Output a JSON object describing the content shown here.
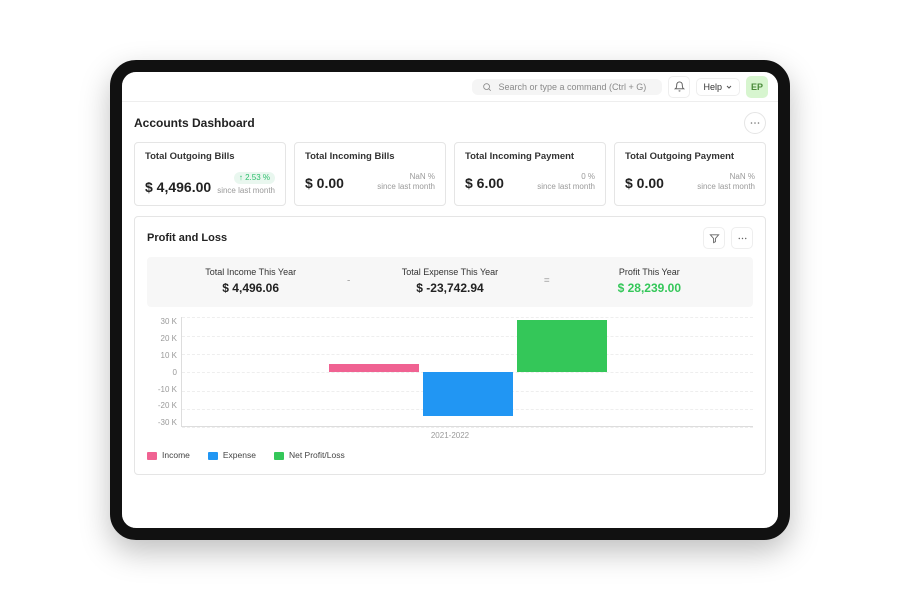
{
  "topbar": {
    "search_placeholder": "Search or type a command  (Ctrl + G)",
    "help_label": "Help",
    "avatar_initials": "EP"
  },
  "page": {
    "title": "Accounts Dashboard"
  },
  "cards": [
    {
      "title": "Total Outgoing Bills",
      "value": "$ 4,496.00",
      "chip": "↑ 2.53 %",
      "meta": "since last month",
      "chip_color": "#2dbf6c"
    },
    {
      "title": "Total Incoming Bills",
      "value": "$ 0.00",
      "chip": "NaN %",
      "meta": "since last month",
      "chip_color": "#9a9a9a"
    },
    {
      "title": "Total Incoming Payment",
      "value": "$ 6.00",
      "chip": "0 %",
      "meta": "since last month",
      "chip_color": "#9a9a9a"
    },
    {
      "title": "Total Outgoing Payment",
      "value": "$ 0.00",
      "chip": "NaN %",
      "meta": "since last month",
      "chip_color": "#9a9a9a"
    }
  ],
  "pnl": {
    "title": "Profit and Loss",
    "summary": [
      {
        "label": "Total Income This Year",
        "value": "$ 4,496.06",
        "op": "-"
      },
      {
        "label": "Total Expense This Year",
        "value": "$ -23,742.94",
        "op": "="
      },
      {
        "label": "Profit This Year",
        "value": "$ 28,239.00",
        "class": "green"
      }
    ],
    "legend": {
      "income": "Income",
      "expense": "Expense",
      "profit": "Net Profit/Loss"
    },
    "xlabel": "2021-2022"
  },
  "chart_data": {
    "type": "bar",
    "title": "Profit and Loss",
    "xlabel": "2021-2022",
    "ylabel": "",
    "ylim": [
      -30000,
      30000
    ],
    "yticks": [
      "30 K",
      "20 K",
      "10 K",
      "0",
      "-10 K",
      "-20 K",
      "-30 K"
    ],
    "categories": [
      "2021-2022"
    ],
    "series": [
      {
        "name": "Income",
        "values": [
          4496.06
        ],
        "color": "#f06292"
      },
      {
        "name": "Expense",
        "values": [
          -23742.94
        ],
        "color": "#2196f3"
      },
      {
        "name": "Net Profit/Loss",
        "values": [
          28239.0
        ],
        "color": "#34c759"
      }
    ]
  }
}
